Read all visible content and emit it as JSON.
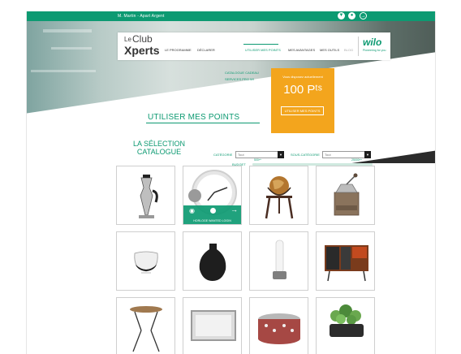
{
  "topbar": {
    "user": "M. Martin - Apart Argent",
    "icons": [
      "cart-icon",
      "user-icon",
      "logout-icon"
    ]
  },
  "logo": {
    "le": "Le",
    "club": "Club",
    "xperts": "Xperts"
  },
  "nav": {
    "items": [
      {
        "label": "LE PROGRAMME"
      },
      {
        "label": "DÉCLARER"
      },
      {
        "label": "UTILISER MES POINTS",
        "active": true
      },
      {
        "label": "MES AVANTAGES"
      },
      {
        "label": "MES OUTILS"
      },
      {
        "label": "BLOG",
        "muted": true
      }
    ],
    "dropdown": [
      "CATALOGUE CADEAU",
      "SERVICES PRO WI"
    ]
  },
  "brand": {
    "name": "wilo",
    "tagline": "Pioneering for you"
  },
  "points": {
    "label": "Vous disposez actuellement",
    "value": "100 Pᵗˢ",
    "button": "UTILISER MES POINTS"
  },
  "section": {
    "title": "UTILISER MES POINTS"
  },
  "catalog": {
    "title_line1": "LA SÉLECTION",
    "title_line2": "CATALOGUE",
    "filters": {
      "category_label": "CATÉGORIE",
      "category_value": "Tout",
      "subcategory_label": "SOUS-CATÉGORIE",
      "subcategory_value": "Tout",
      "budget_label": "BUDGET",
      "budget_min": "500ᵖᵗˢ",
      "budget_max": "25000ᵖᵗˢ"
    },
    "hover_label": "HORLOGE WANTED LOGIN",
    "products": [
      {
        "icon": "coffee-maker-icon"
      },
      {
        "icon": "wall-clock-icon"
      },
      {
        "icon": "globe-icon"
      },
      {
        "icon": "coffee-grinder-icon"
      },
      {
        "icon": "wine-glass-icon"
      },
      {
        "icon": "vase-icon"
      },
      {
        "icon": "air-purifier-icon"
      },
      {
        "icon": "cabinet-icon"
      },
      {
        "icon": "side-table-icon"
      },
      {
        "icon": "mirror-icon"
      },
      {
        "icon": "pouf-icon"
      },
      {
        "icon": "planter-icon"
      }
    ]
  },
  "colors": {
    "brand_green": "#0d9a72",
    "accent_orange": "#f3a51d"
  }
}
